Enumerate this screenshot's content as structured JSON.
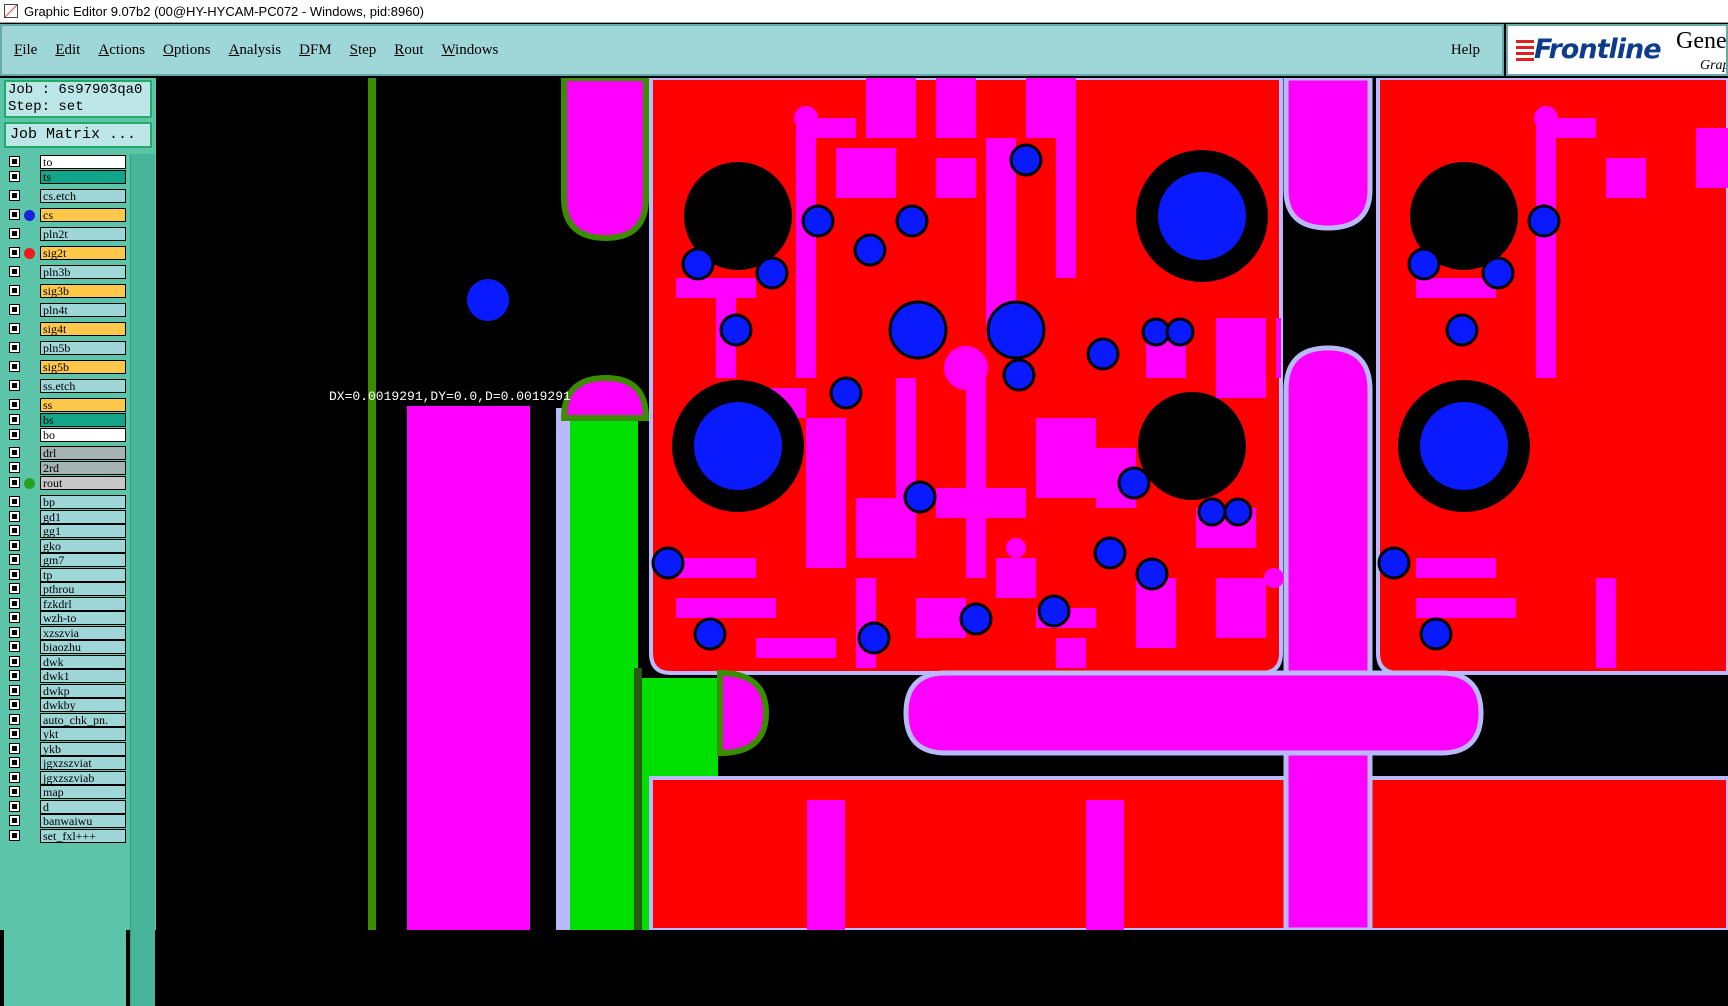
{
  "window": {
    "title": "Graphic Editor 9.07b2 (00@HY-HYCAM-PC072 - Windows, pid:8960)"
  },
  "menu": {
    "items": [
      {
        "label": "File",
        "key": "F",
        "rest": "ile"
      },
      {
        "label": "Edit",
        "key": "E",
        "rest": "dit"
      },
      {
        "label": "Actions",
        "key": "A",
        "rest": "ctions"
      },
      {
        "label": "Options",
        "key": "O",
        "rest": "ptions"
      },
      {
        "label": "Analysis",
        "key": "A",
        "rest": "nalysis"
      },
      {
        "label": "DFM",
        "key": "D",
        "rest": "FM"
      },
      {
        "label": "Step",
        "key": "S",
        "rest": "tep"
      },
      {
        "label": "Rout",
        "key": "R",
        "rest": "out"
      },
      {
        "label": "Windows",
        "key": "W",
        "rest": "indows"
      }
    ],
    "help": "Help"
  },
  "brand": {
    "name": "Frontline",
    "product": "Gene",
    "subtitle": "Grap"
  },
  "job": {
    "job_line": "Job : 6s97903qa0",
    "step_line": "Step: set",
    "matrix_button": "Job Matrix ..."
  },
  "layers": [
    {
      "name": "to",
      "bg": "#ffffff",
      "dot": null
    },
    {
      "name": "ts",
      "bg": "#12a58a",
      "dot": null
    },
    {
      "name": "cs.etch",
      "bg": "#9fd7d9",
      "dot": null
    },
    {
      "name": "cs",
      "bg": "#ffc84a",
      "dot": "#1a22e0"
    },
    {
      "name": "pln2t",
      "bg": "#9fd7d9",
      "dot": null
    },
    {
      "name": "sig2t",
      "bg": "#ffc84a",
      "dot": "#ee1c1c"
    },
    {
      "name": "pln3b",
      "bg": "#9fd7d9",
      "dot": null
    },
    {
      "name": "sig3b",
      "bg": "#ffc84a",
      "dot": null
    },
    {
      "name": "pln4t",
      "bg": "#9fd7d9",
      "dot": null
    },
    {
      "name": "sig4t",
      "bg": "#ffc84a",
      "dot": null
    },
    {
      "name": "pln5b",
      "bg": "#9fd7d9",
      "dot": null
    },
    {
      "name": "sig5b",
      "bg": "#ffc84a",
      "dot": null
    },
    {
      "name": "ss.etch",
      "bg": "#9fd7d9",
      "dot": null
    },
    {
      "name": "ss",
      "bg": "#ffc84a",
      "dot": null
    },
    {
      "name": "bs",
      "bg": "#12a58a",
      "dot": null
    },
    {
      "name": "bo",
      "bg": "#ffffff",
      "dot": null
    },
    {
      "name": "drl",
      "bg": "#a6b3b3",
      "dot": null
    },
    {
      "name": "2rd",
      "bg": "#a6b3b3",
      "dot": null
    },
    {
      "name": "rout",
      "bg": "#c8c8c8",
      "dot": "#2aa020"
    },
    {
      "name": "bp",
      "bg": "#9fd7d9",
      "dot": null
    },
    {
      "name": "gd1",
      "bg": "#9fd7d9",
      "dot": null
    },
    {
      "name": "gg1",
      "bg": "#9fd7d9",
      "dot": null
    },
    {
      "name": "gko",
      "bg": "#9fd7d9",
      "dot": null
    },
    {
      "name": "gm7",
      "bg": "#9fd7d9",
      "dot": null
    },
    {
      "name": "tp",
      "bg": "#9fd7d9",
      "dot": null
    },
    {
      "name": "pthrou",
      "bg": "#9fd7d9",
      "dot": null
    },
    {
      "name": "fzkdrl",
      "bg": "#9fd7d9",
      "dot": null
    },
    {
      "name": "wzh-to",
      "bg": "#9fd7d9",
      "dot": null
    },
    {
      "name": "xzszvia",
      "bg": "#9fd7d9",
      "dot": null
    },
    {
      "name": "biaozhu",
      "bg": "#9fd7d9",
      "dot": null
    },
    {
      "name": "dwk",
      "bg": "#9fd7d9",
      "dot": null
    },
    {
      "name": "dwk1",
      "bg": "#9fd7d9",
      "dot": null
    },
    {
      "name": "dwkp",
      "bg": "#9fd7d9",
      "dot": null
    },
    {
      "name": "dwkby",
      "bg": "#9fd7d9",
      "dot": null
    },
    {
      "name": "auto_chk_pn.",
      "bg": "#9fd7d9",
      "dot": null
    },
    {
      "name": "ykt",
      "bg": "#9fd7d9",
      "dot": null
    },
    {
      "name": "ykb",
      "bg": "#9fd7d9",
      "dot": null
    },
    {
      "name": "jgxzszviat",
      "bg": "#9fd7d9",
      "dot": null
    },
    {
      "name": "jgxzszviab",
      "bg": "#9fd7d9",
      "dot": null
    },
    {
      "name": "map",
      "bg": "#9fd7d9",
      "dot": null
    },
    {
      "name": "d",
      "bg": "#9fd7d9",
      "dot": null
    },
    {
      "name": "banwaiwu",
      "bg": "#9fd7d9",
      "dot": null
    },
    {
      "name": "set_fxl+++",
      "bg": "#9fd7d9",
      "dot": null
    }
  ],
  "canvas": {
    "measure_readout": "DX=0.0019291,DY=0.0,D=0.0019291"
  },
  "colors": {
    "copper_red": "#ff0000",
    "pad_magenta": "#ff00ff",
    "via_blue": "#0a1aff",
    "rout_green": "#00e000",
    "outline_green": "#3c8c00",
    "clearance_lavender": "#b9b9ff"
  },
  "icons": {
    "title_icon": "app-icon",
    "brand_mark": "frontline-logo"
  }
}
